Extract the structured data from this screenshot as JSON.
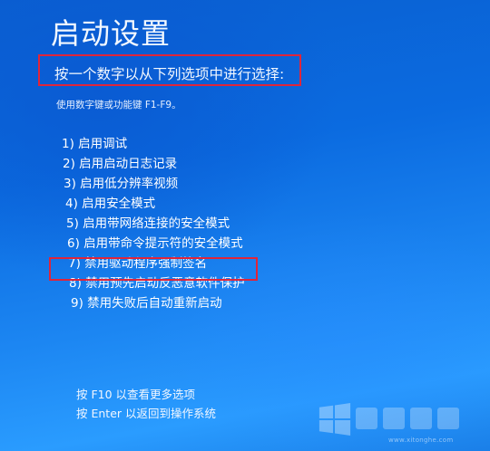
{
  "screen": {
    "title": "启动设置",
    "prompt": "按一个数字以从下列选项中进行选择:",
    "hint": "使用数字键或功能键 F1-F9。"
  },
  "options": [
    {
      "label": "1) 启用调试"
    },
    {
      "label": "2) 启用启动日志记录"
    },
    {
      "label": "3) 启用低分辨率视频"
    },
    {
      "label": "4) 启用安全模式"
    },
    {
      "label": "5) 启用带网络连接的安全模式"
    },
    {
      "label": "6) 启用带命令提示符的安全模式"
    },
    {
      "label": "7) 禁用驱动程序强制签名",
      "highlighted": true
    },
    {
      "label": "8) 禁用预先启动反恶意软件保护"
    },
    {
      "label": "9) 禁用失败后自动重新启动"
    }
  ],
  "footer": {
    "more_options": "按 F10 以查看更多选项",
    "return_os": "按 Enter 以返回到操作系统"
  },
  "watermark": {
    "url": "www.xitonghe.com",
    "icon": "windows-logo-icon"
  },
  "colors": {
    "background": "#0b6be0",
    "annotation": "#e0253a",
    "text": "#ffffff"
  }
}
